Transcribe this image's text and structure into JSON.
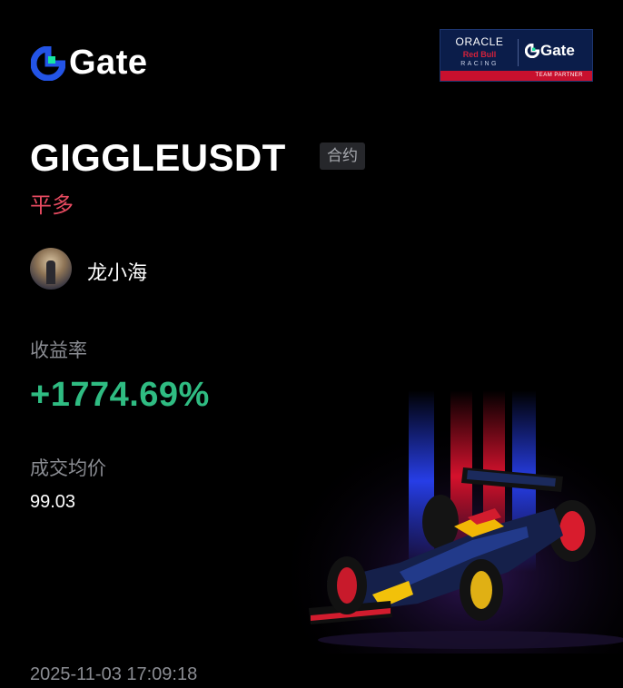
{
  "brand": {
    "logo_text": "Gate"
  },
  "partner_badge": {
    "oracle": "ORACLE",
    "redbull": "Red Bull",
    "racing": "RACING",
    "gate": "Gate",
    "bar_text": "TEAM PARTNER"
  },
  "trade": {
    "symbol": "GIGGLEUSDT",
    "contract_tag": "合约",
    "direction": "平多",
    "user_name": "龙小海",
    "yield_label": "收益率",
    "yield_value": "+1774.69%",
    "avg_price_label": "成交均价",
    "avg_price_value": "99.03",
    "timestamp": "2025-11-03 17:09:18"
  },
  "colors": {
    "background": "#000000",
    "positive": "#2fbc82",
    "direction_red": "#e64a60",
    "brand_blue": "#2354e6",
    "brand_green": "#17e6a1"
  },
  "icons": {
    "logo_mark": "gate-logo-icon",
    "car": "f1-car-image"
  }
}
